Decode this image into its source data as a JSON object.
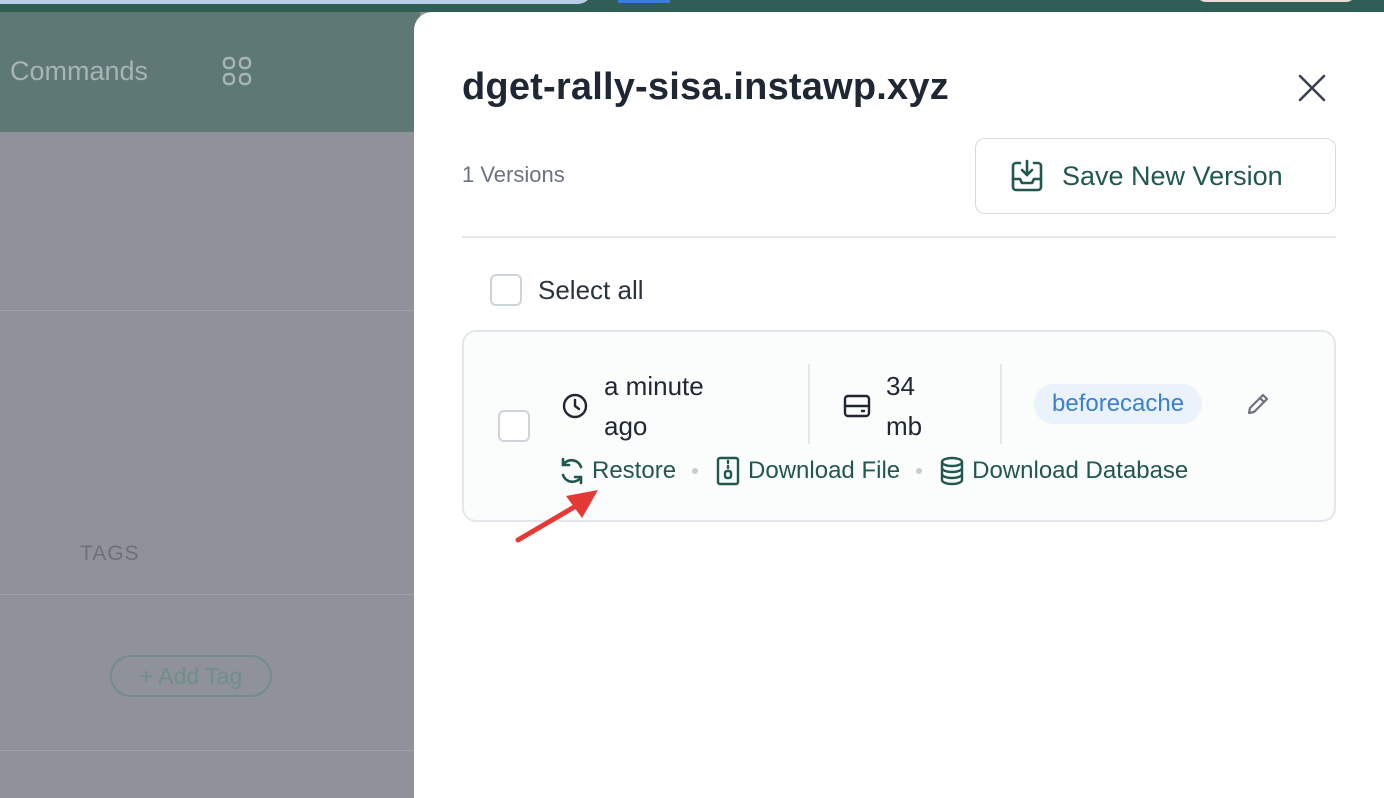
{
  "background": {
    "commands_label": "Commands",
    "tags_header": "TAGS",
    "add_tag_label": "+ Add Tag"
  },
  "drawer": {
    "title": "dget-rally-sisa.instawp.xyz",
    "versions_count": "1 Versions",
    "save_button": {
      "label": "Save New Version",
      "icon": "download-tray-icon"
    },
    "select_all_label": "Select all",
    "versions": [
      {
        "time": "a minute ago",
        "size": "34 mb",
        "tag": "beforecache",
        "actions": {
          "restore": "Restore",
          "download_file": "Download File",
          "download_database": "Download Database"
        }
      }
    ]
  },
  "colors": {
    "accent": "#21574f",
    "tag_text": "#3b7fd1",
    "tag_bg": "#eaf2fb",
    "annotation_arrow": "#e53935",
    "overlay": "#8f929a"
  }
}
